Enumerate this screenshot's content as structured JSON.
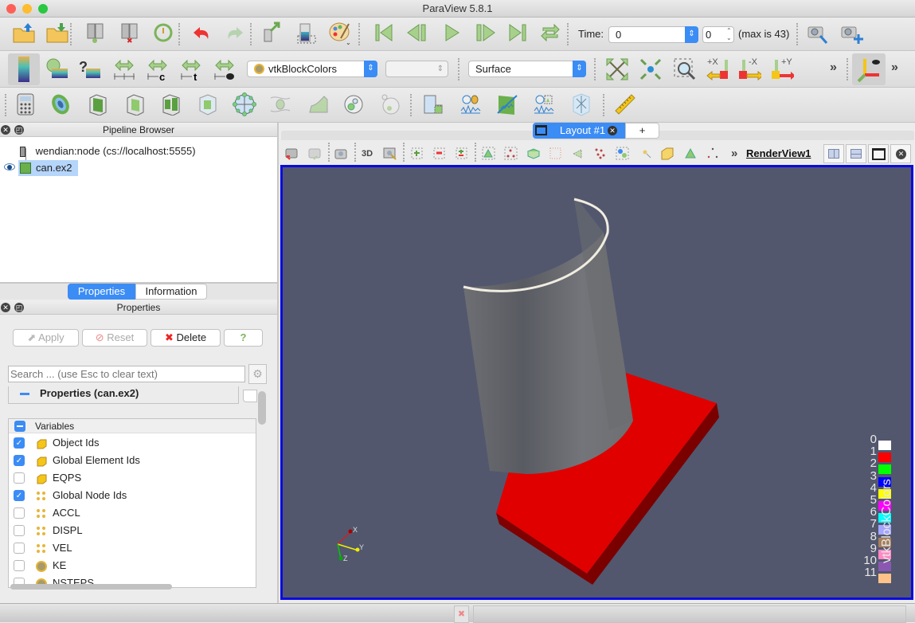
{
  "window": {
    "title": "ParaView 5.8.1"
  },
  "toolbar_main": {
    "icons": [
      "open-file-icon",
      "save-data-icon",
      "connect-icon",
      "disconnect-icon",
      "reset-session-icon",
      "undo-icon",
      "redo-icon",
      "save-state-icon",
      "color-map-editor-icon",
      "color-palette-icon",
      "first-frame-icon",
      "previous-frame-icon",
      "play-icon",
      "next-frame-icon",
      "last-frame-icon",
      "loop-icon",
      "find-data-icon",
      "add-camera-icon"
    ],
    "time_label": "Time:",
    "time_value": "0",
    "timestep_value": "0",
    "max_label": "(max is 43)"
  },
  "toolbar_color": {
    "color_by": "vtkBlockColors",
    "component": "",
    "representation": "Surface",
    "axis_buttons": [
      "+X",
      "-X",
      "+Y"
    ],
    "more": "»"
  },
  "toolbar_filters": {
    "icons": [
      "calculator-icon",
      "contour-icon",
      "clip-icon",
      "slice-icon",
      "threshold-icon",
      "extract-subset-icon",
      "glyph-icon",
      "stream-tracer-icon",
      "warp-by-vector-icon",
      "group-datasets-icon",
      "extract-level-icon",
      "extract-selection-icon",
      "plot-over-time-icon",
      "plot-over-line-icon",
      "plot-selection-over-time-icon",
      "slice-plane-icon",
      "ruler-icon"
    ]
  },
  "pipeline_browser": {
    "title": "Pipeline Browser",
    "items": [
      {
        "label": "wendian:node (cs://localhost:5555)",
        "type": "server"
      },
      {
        "label": "can.ex2",
        "type": "source",
        "selected": true,
        "visible": true
      }
    ]
  },
  "panel_tabs": [
    {
      "label": "Properties",
      "active": true
    },
    {
      "label": "Information",
      "active": false
    }
  ],
  "properties": {
    "title": "Properties",
    "apply_label": "Apply",
    "reset_label": "Reset",
    "delete_label": "Delete",
    "help_label": "?",
    "search_placeholder": "Search ... (use Esc to clear text)",
    "section_title": "Properties (can.ex2)",
    "variables_header": "Variables",
    "variables": [
      {
        "label": "Object Ids",
        "checked": true,
        "kind": "cell"
      },
      {
        "label": "Global Element Ids",
        "checked": true,
        "kind": "cell"
      },
      {
        "label": "EQPS",
        "checked": false,
        "kind": "cell"
      },
      {
        "label": "Global Node Ids",
        "checked": true,
        "kind": "point"
      },
      {
        "label": "ACCL",
        "checked": false,
        "kind": "point"
      },
      {
        "label": "DISPL",
        "checked": false,
        "kind": "point"
      },
      {
        "label": "VEL",
        "checked": false,
        "kind": "point"
      },
      {
        "label": "KE",
        "checked": false,
        "kind": "field"
      },
      {
        "label": "NSTEPS",
        "checked": false,
        "kind": "field"
      }
    ]
  },
  "layout": {
    "tab_label": "Layout #1",
    "add_tab": "+",
    "view_name": "RenderView1",
    "toolbar_3d": "3D",
    "more": "»"
  },
  "render_view": {
    "background": "#52576e",
    "legend": {
      "title": "vtkBlockColors",
      "entries": [
        {
          "label": "0",
          "color": "#ffffff"
        },
        {
          "label": "1",
          "color": "#ff0000"
        },
        {
          "label": "2",
          "color": "#00ff00"
        },
        {
          "label": "3",
          "color": "#0000ff"
        },
        {
          "label": "4",
          "color": "#ffff00"
        },
        {
          "label": "5",
          "color": "#ff00ff"
        },
        {
          "label": "6",
          "color": "#00ffff"
        },
        {
          "label": "7",
          "color": "#a6a6ff"
        },
        {
          "label": "8",
          "color": "#a67f5c"
        },
        {
          "label": "9",
          "color": "#ff88c3"
        },
        {
          "label": "10",
          "color": "#8a58b0"
        },
        {
          "label": "11",
          "color": "#ffc389"
        }
      ]
    },
    "axes": {
      "x": "X",
      "y": "Y",
      "z": "Z"
    }
  }
}
